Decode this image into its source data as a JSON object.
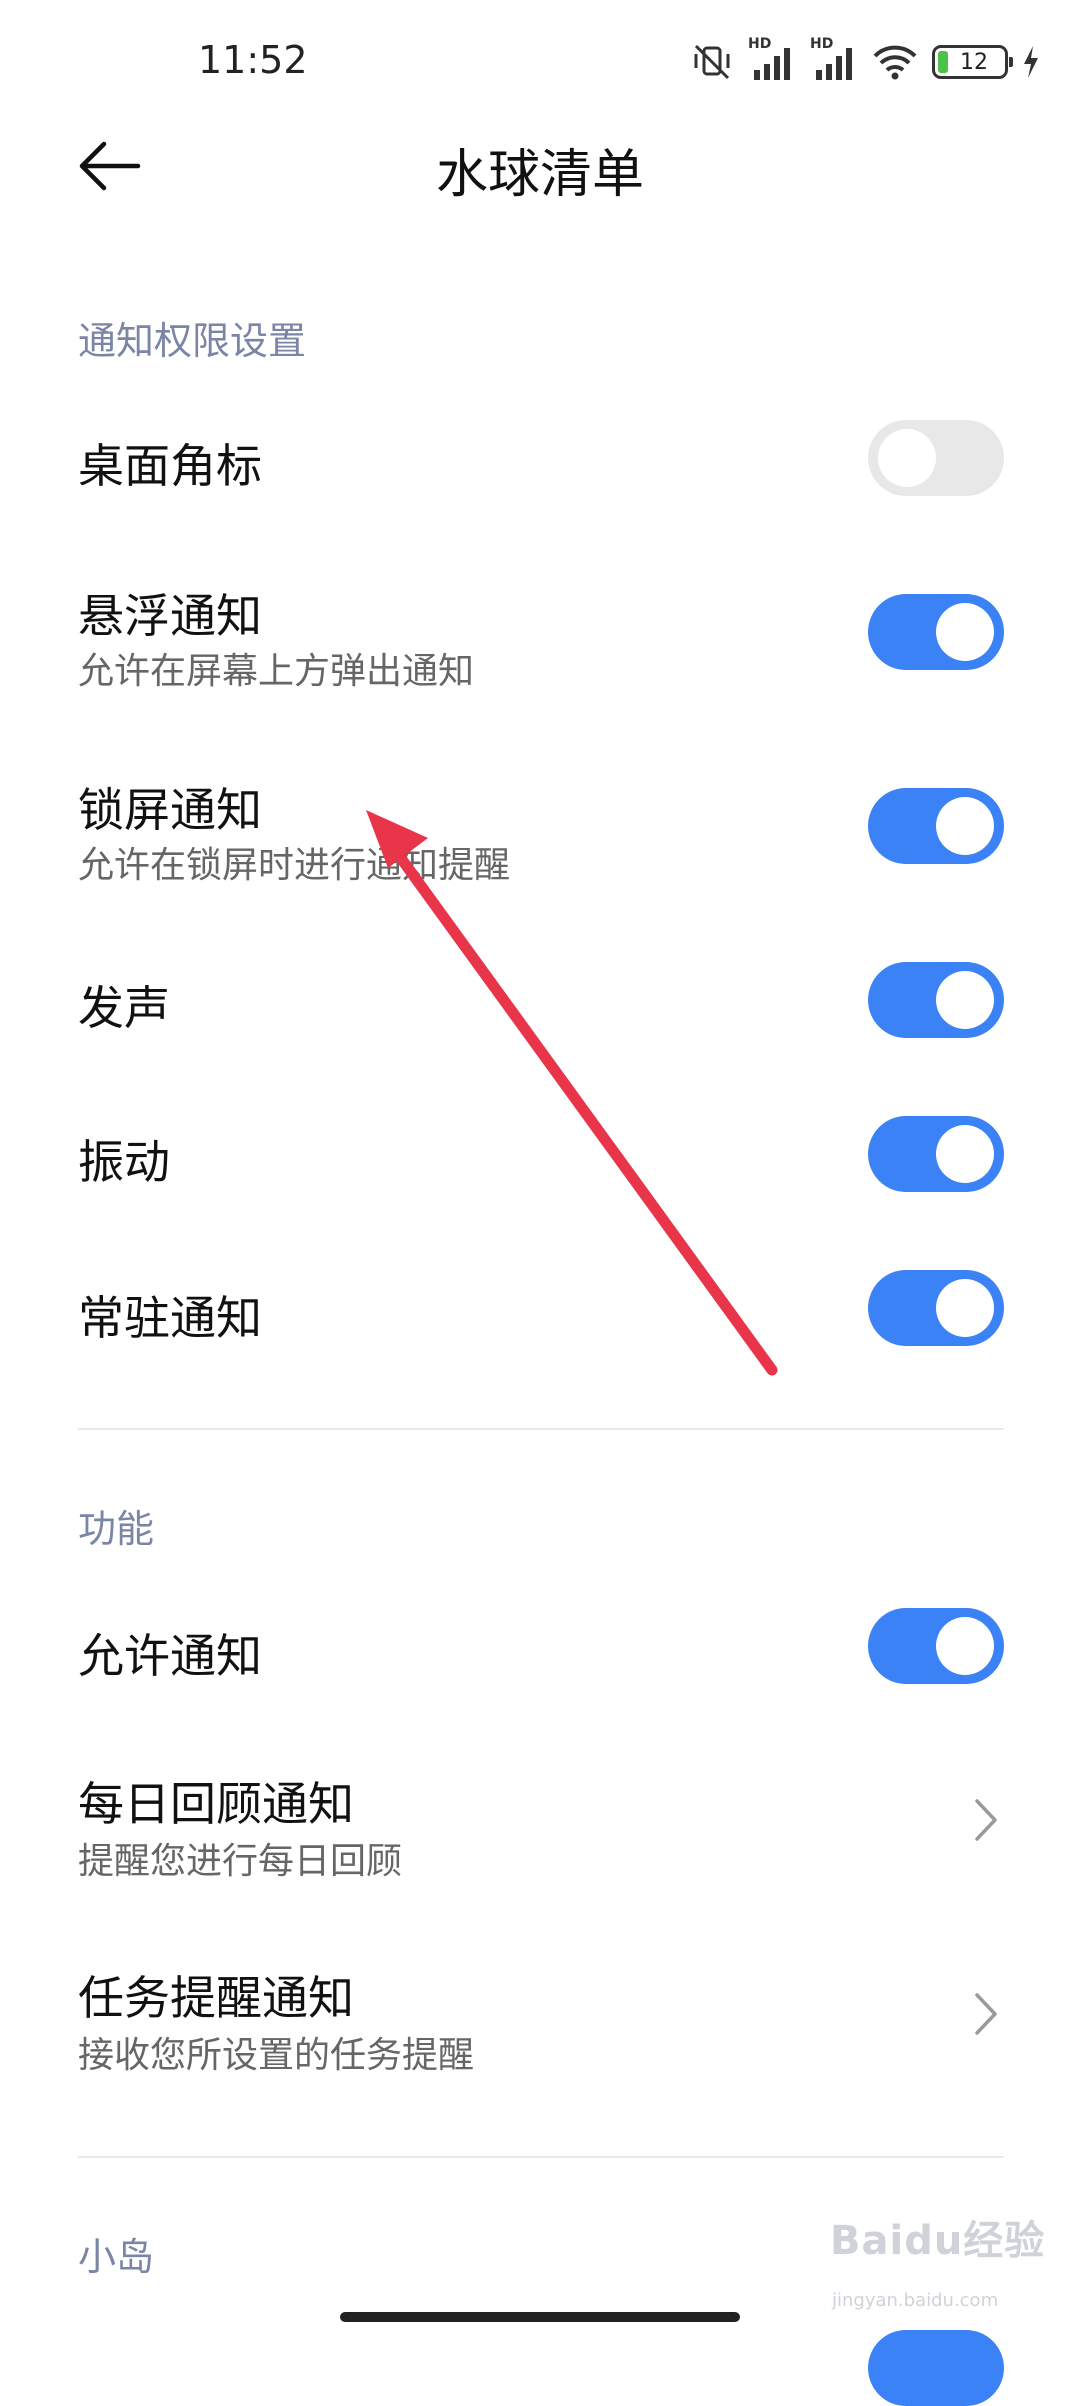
{
  "status_bar": {
    "time": "11:52",
    "battery_level": "12",
    "network_labels": [
      "HD",
      "HD"
    ],
    "icons": [
      "mute-vibrate-icon",
      "signal-hd-icon",
      "signal-hd-icon",
      "wifi-icon",
      "battery-icon",
      "charging-icon"
    ]
  },
  "header": {
    "title": "水球清单",
    "back_icon": "back-arrow-icon"
  },
  "sections": {
    "notification_permissions": {
      "title": "通知权限设置",
      "rows": [
        {
          "title": "桌面角标",
          "subtitle": "",
          "toggle": false
        },
        {
          "title": "悬浮通知",
          "subtitle": "允许在屏幕上方弹出通知",
          "toggle": true
        },
        {
          "title": "锁屏通知",
          "subtitle": "允许在锁屏时进行通知提醒",
          "toggle": true
        },
        {
          "title": "发声",
          "subtitle": "",
          "toggle": true
        },
        {
          "title": "振动",
          "subtitle": "",
          "toggle": true
        },
        {
          "title": "常驻通知",
          "subtitle": "",
          "toggle": true
        }
      ]
    },
    "features": {
      "title": "功能",
      "rows": [
        {
          "title": "允许通知",
          "subtitle": "",
          "toggle": true
        },
        {
          "title": "每日回顾通知",
          "subtitle": "提醒您进行每日回顾",
          "action": "chevron-right-icon"
        },
        {
          "title": "任务提醒通知",
          "subtitle": "接收您所设置的任务提醒",
          "action": "chevron-right-icon"
        }
      ]
    },
    "island": {
      "title": "小岛"
    }
  },
  "colors": {
    "accent": "#3b82f6",
    "toggle_off": "#e8e8e8",
    "section_title": "#7b86a6",
    "annotation_arrow": "#e8354a"
  },
  "watermark": {
    "brand": "Baidu经验",
    "url": "jingyan.baidu.com"
  }
}
